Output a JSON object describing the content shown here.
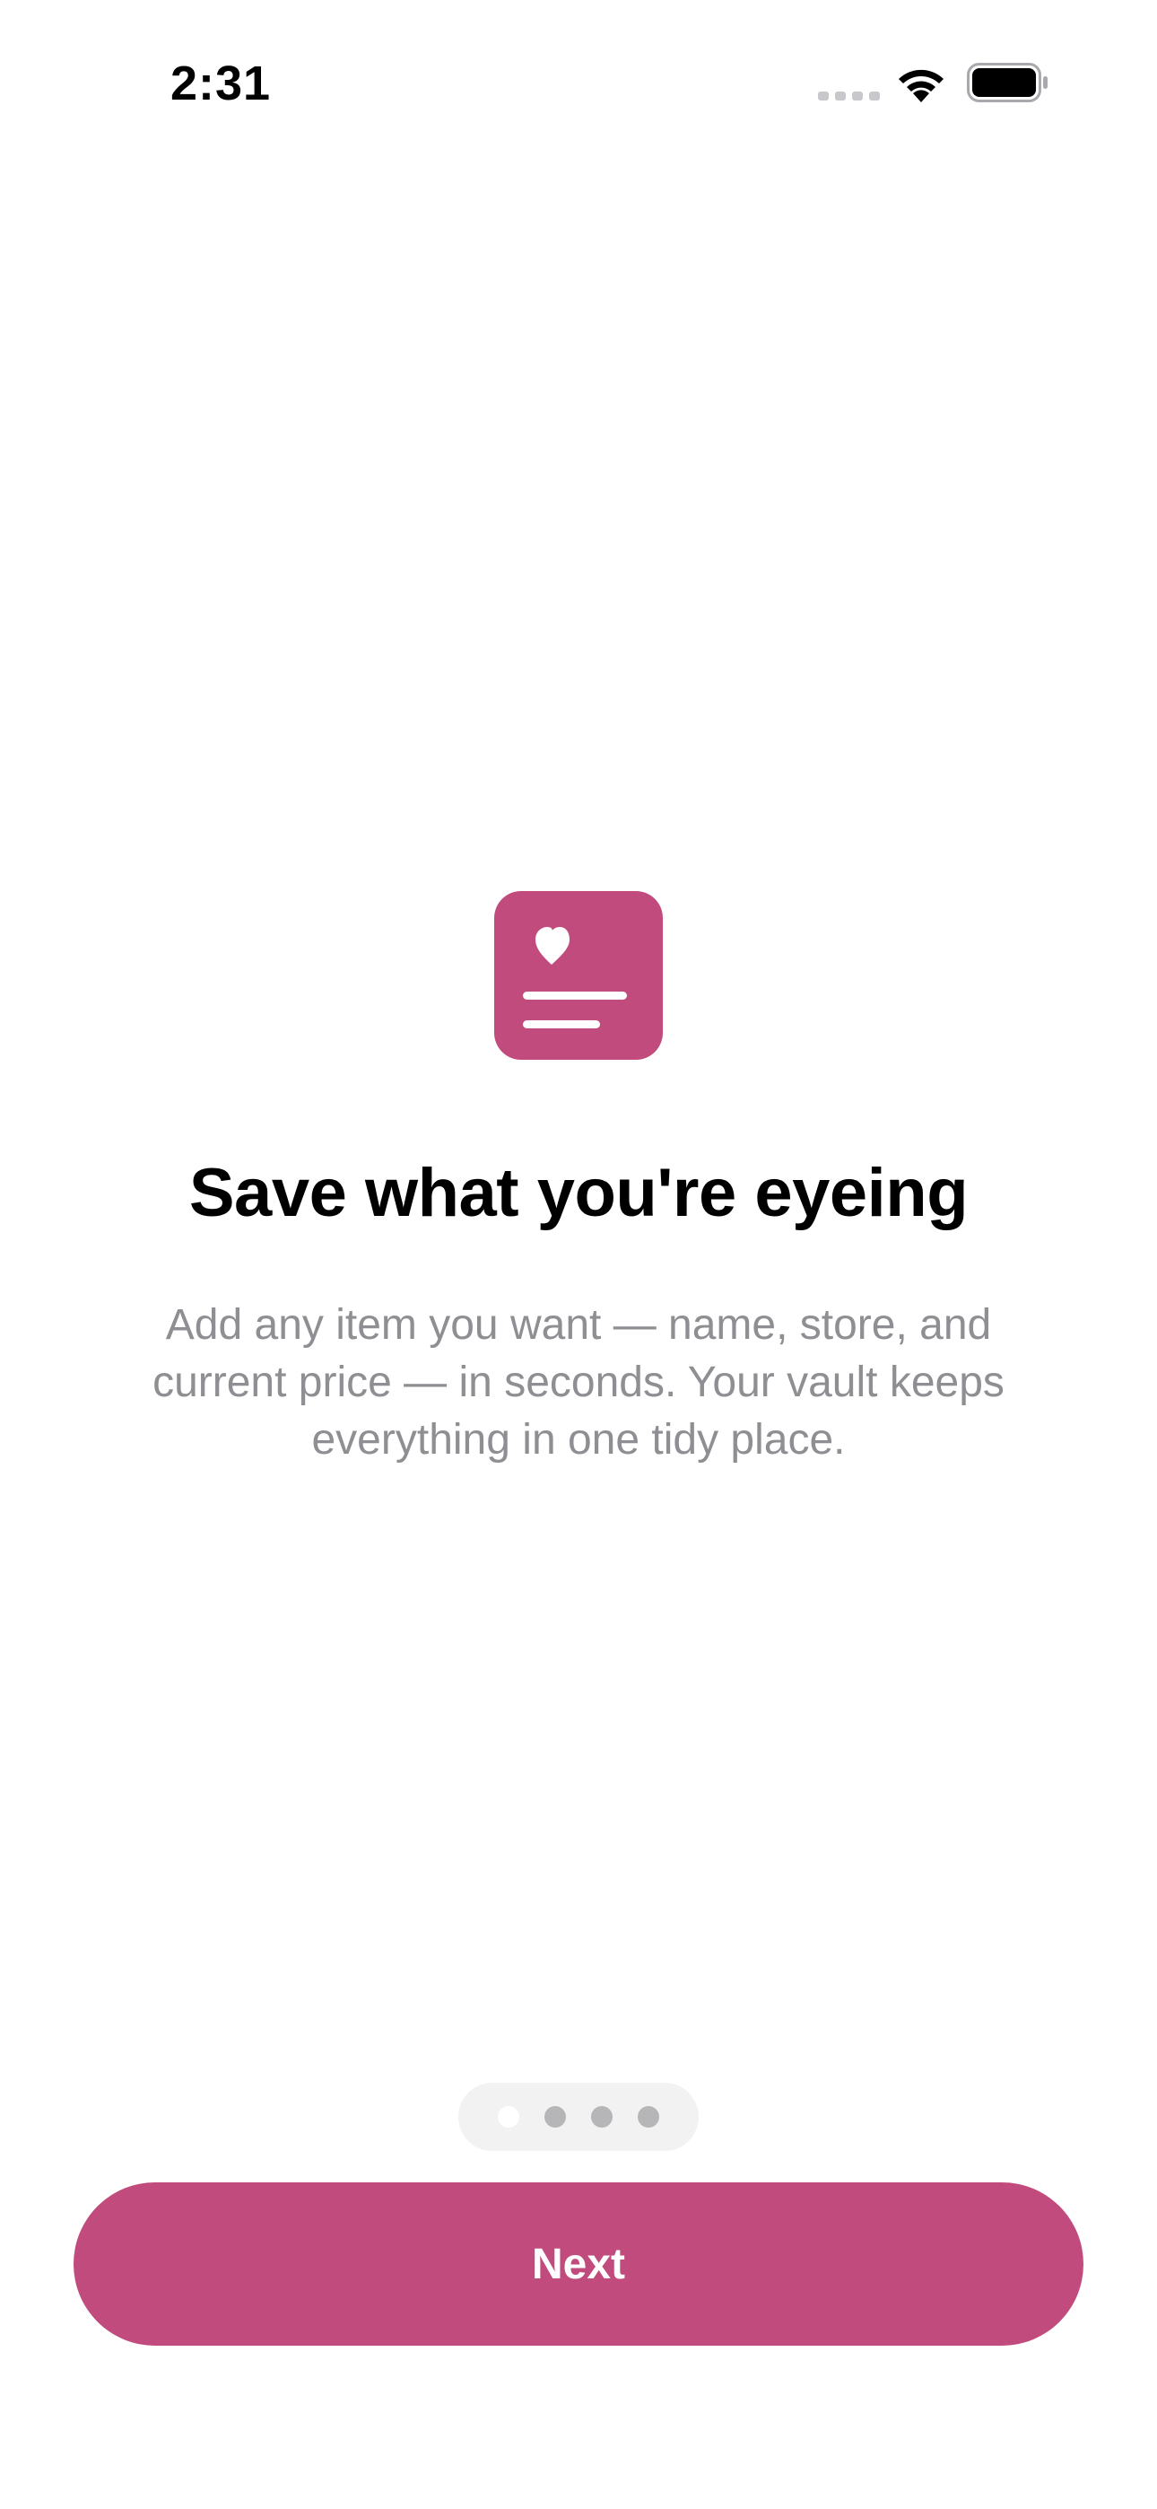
{
  "status_bar": {
    "time": "2:31",
    "icons": [
      "cellular-signal-icon",
      "wifi-icon",
      "battery-icon"
    ]
  },
  "hero": {
    "icon": "saved-item-card-icon",
    "title": "Save what you're eyeing",
    "description": "Add any item you want — name, store, and current price — in seconds. Your vault keeps everything in one tidy place."
  },
  "page_indicator": {
    "total_pages": 4,
    "current_page": 1
  },
  "actions": {
    "next_label": "Next"
  },
  "colors": {
    "accent": "#c14b7c",
    "text_primary": "#000000",
    "text_secondary": "#8e8e93",
    "indicator_bg": "#f2f2f3",
    "indicator_dot": "#b6b6b9",
    "indicator_dot_active": "#ffffff"
  }
}
